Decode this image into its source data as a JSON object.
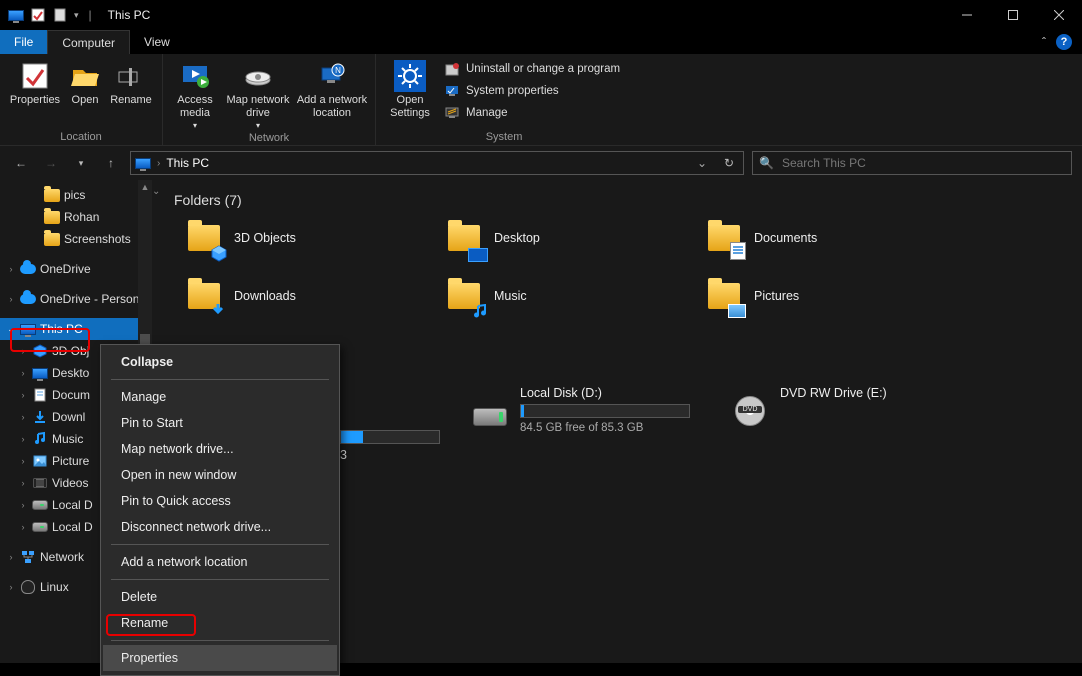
{
  "window": {
    "title": "This PC"
  },
  "tabs": {
    "file": "File",
    "computer": "Computer",
    "view": "View"
  },
  "ribbon": {
    "location": {
      "label": "Location",
      "properties": "Properties",
      "open": "Open",
      "rename": "Rename"
    },
    "network": {
      "label": "Network",
      "access_media": "Access media",
      "map_drive": "Map network drive",
      "add_location": "Add a network location"
    },
    "settings": {
      "open_settings": "Open Settings"
    },
    "system": {
      "label": "System",
      "uninstall": "Uninstall or change a program",
      "props": "System properties",
      "manage": "Manage"
    }
  },
  "address": {
    "path": "This PC"
  },
  "search": {
    "placeholder": "Search This PC"
  },
  "tree": {
    "pics": "pics",
    "rohan": "Rohan",
    "screenshots": "Screenshots",
    "onedrive": "OneDrive",
    "onedrive_personal": "OneDrive - Person",
    "this_pc": "This PC",
    "objects3d": "3D Obj",
    "desktop": "Deskto",
    "documents": "Docum",
    "downloads": "Downl",
    "music": "Music",
    "pictures": "Picture",
    "videos": "Videos",
    "local_c": "Local D",
    "local_d": "Local D",
    "network": "Network",
    "linux": "Linux"
  },
  "folders": {
    "header": "Folders (7)",
    "items": [
      "3D Objects",
      "Desktop",
      "Documents",
      "Downloads",
      "Music",
      "Pictures"
    ]
  },
  "drives": {
    "partial_num": "3",
    "d": {
      "name": "Local Disk (D:)",
      "free": "84.5 GB free of 85.3 GB",
      "fill_pct": 2
    },
    "e": {
      "name": "DVD RW Drive (E:)",
      "dvd_label": "DVD"
    }
  },
  "context_menu": {
    "collapse": "Collapse",
    "manage": "Manage",
    "pin_start": "Pin to Start",
    "map_drive": "Map network drive...",
    "open_new": "Open in new window",
    "pin_qa": "Pin to Quick access",
    "disconnect": "Disconnect network drive...",
    "add_loc": "Add a network location",
    "delete": "Delete",
    "rename": "Rename",
    "properties": "Properties"
  }
}
